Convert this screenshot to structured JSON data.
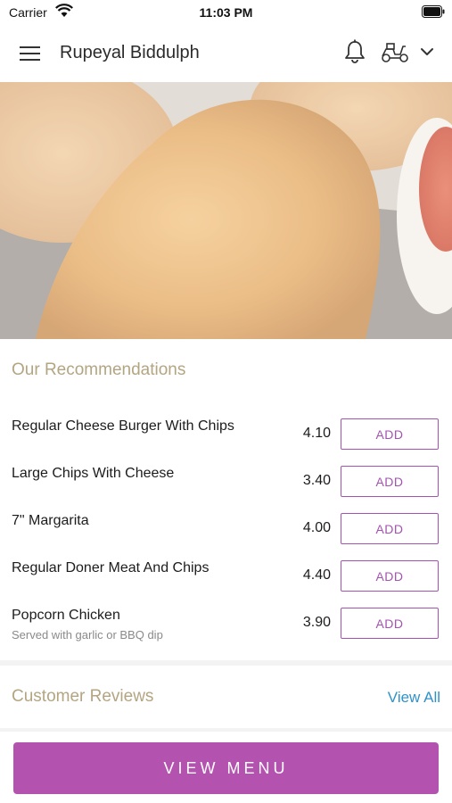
{
  "status_bar": {
    "carrier": "Carrier",
    "time": "11:03 PM",
    "icons": [
      "wifi-icon",
      "battery-icon"
    ]
  },
  "header": {
    "title": "Rupeyal Biddulph",
    "icons": [
      "hamburger-menu-icon",
      "bell-icon",
      "scooter-icon",
      "chevron-down-icon"
    ]
  },
  "hero": {
    "image": "fried chicken nuggets with dipping sauce"
  },
  "recommendations": {
    "heading": "Our Recommendations",
    "items": [
      {
        "name": "Regular Cheese Burger With Chips",
        "description": "",
        "price": "4.10",
        "button": "ADD"
      },
      {
        "name": "Large Chips With Cheese",
        "description": "",
        "price": "3.40",
        "button": "ADD"
      },
      {
        "name": "7\" Margarita",
        "description": "",
        "price": "4.00",
        "button": "ADD"
      },
      {
        "name": "Regular Doner Meat And Chips",
        "description": "",
        "price": "4.40",
        "button": "ADD"
      },
      {
        "name": "Popcorn Chicken",
        "description": "Served with garlic or BBQ dip",
        "price": "3.90",
        "button": "ADD"
      }
    ]
  },
  "reviews": {
    "heading": "Customer Reviews",
    "view_all": "View All"
  },
  "footer": {
    "view_menu": "VIEW MENU"
  },
  "colors": {
    "accent": "#b452b0",
    "heading": "#b4a582",
    "link": "#2f92c9"
  }
}
